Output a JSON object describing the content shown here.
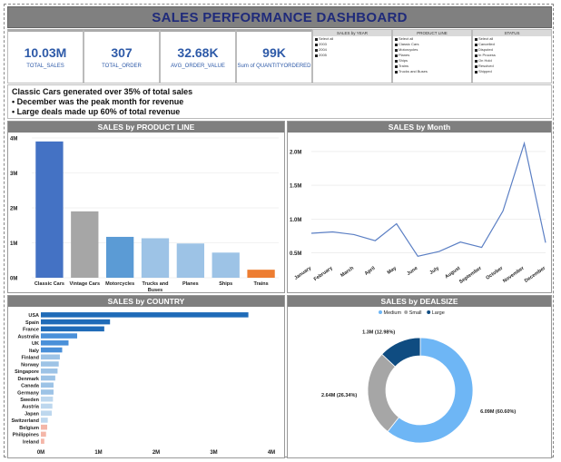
{
  "title": "SALES PERFORMANCE DASHBOARD",
  "kpis": [
    {
      "value": "10.03M",
      "label": "TOTAL_SALES"
    },
    {
      "value": "307",
      "label": "TOTAL_ORDER"
    },
    {
      "value": "32.68K",
      "label": "AVG_ORDER_VALUE"
    },
    {
      "value": "99K",
      "label": "Sum of QUANTITYORDERED"
    }
  ],
  "slicers": [
    {
      "title": "SALES by YEAR",
      "items": [
        "Select all",
        "2003",
        "2004",
        "2005"
      ]
    },
    {
      "title": "PRODUCT LINE",
      "items": [
        "Select all",
        "Classic Cars",
        "Motorcycles",
        "Planes",
        "Ships",
        "Trains",
        "Trucks and Buses"
      ]
    },
    {
      "title": "STATUS",
      "items": [
        "Select all",
        "Cancelled",
        "Disputed",
        "In Process",
        "On Hold",
        "Resolved",
        "Shipped"
      ]
    }
  ],
  "insights": [
    "Classic Cars generated over 35% of total sales",
    "December was the peak month for revenue",
    "Large deals made up 60% of total revenue"
  ],
  "colors": {
    "header": "#7f7f7f",
    "title": "#1f2a7a",
    "kpi": "#2e5aa8"
  },
  "chart_data": [
    {
      "type": "bar",
      "title": "SALES by PRODUCT LINE",
      "categories": [
        "Classic Cars",
        "Vintage Cars",
        "Motorcycles",
        "Trucks and Buses",
        "Planes",
        "Ships",
        "Trains"
      ],
      "values": [
        3.9,
        1.9,
        1.17,
        1.13,
        0.98,
        0.72,
        0.23
      ],
      "colors": [
        "#4472c4",
        "#a6a6a6",
        "#5b9bd5",
        "#9dc3e6",
        "#9dc3e6",
        "#9dc3e6",
        "#ed7d31"
      ],
      "yticks": [
        "0M",
        "1M",
        "2M",
        "3M",
        "4M"
      ],
      "ylim": [
        0,
        4
      ],
      "grid": true
    },
    {
      "type": "line",
      "title": "SALES by Month",
      "categories": [
        "January",
        "February",
        "March",
        "April",
        "May",
        "June",
        "July",
        "August",
        "September",
        "October",
        "November",
        "December"
      ],
      "values": [
        0.79,
        0.81,
        0.77,
        0.68,
        0.93,
        0.45,
        0.52,
        0.66,
        0.58,
        1.12,
        2.12,
        0.65
      ],
      "yticks": [
        "0.5M",
        "1.0M",
        "1.5M",
        "2.0M"
      ],
      "ylim": [
        0.4,
        2.2
      ],
      "color": "#5b7fc4",
      "grid": true
    },
    {
      "type": "bar",
      "orientation": "horizontal",
      "title": "SALES by COUNTRY",
      "categories": [
        "USA",
        "Spain",
        "France",
        "Australia",
        "UK",
        "Italy",
        "Finland",
        "Norway",
        "Singapore",
        "Denmark",
        "Canada",
        "Germany",
        "Sweden",
        "Austria",
        "Japan",
        "Switzerland",
        "Belgium",
        "Philippines",
        "Ireland"
      ],
      "values": [
        3.6,
        1.2,
        1.1,
        0.63,
        0.48,
        0.37,
        0.33,
        0.31,
        0.29,
        0.25,
        0.22,
        0.22,
        0.21,
        0.2,
        0.19,
        0.12,
        0.11,
        0.09,
        0.06
      ],
      "colors": [
        "#1f6bb8",
        "#1f6bb8",
        "#1f6bb8",
        "#4a90d9",
        "#4a90d9",
        "#4a90d9",
        "#9dc3e6",
        "#9dc3e6",
        "#9dc3e6",
        "#9dc3e6",
        "#9dc3e6",
        "#9dc3e6",
        "#bdd7ee",
        "#bdd7ee",
        "#bdd7ee",
        "#bdd7ee",
        "#f4b6a8",
        "#f4b6a8",
        "#f4b6a8"
      ],
      "xticks": [
        "0M",
        "1M",
        "2M",
        "3M",
        "4M"
      ],
      "xlim": [
        0,
        4
      ]
    },
    {
      "type": "pie",
      "donut": true,
      "title": "SALES by DEALSIZE",
      "legend": [
        "Medium",
        "Small",
        "Large"
      ],
      "legend_position": "top",
      "values": [
        60.6,
        26.34,
        12.98
      ],
      "labels": [
        "6.09M (60.60%)",
        "2.64M (26.34%)",
        "1.3M (12.98%)"
      ],
      "colors": [
        "#6eb6f5",
        "#a6a6a6",
        "#0f4c81"
      ]
    }
  ]
}
